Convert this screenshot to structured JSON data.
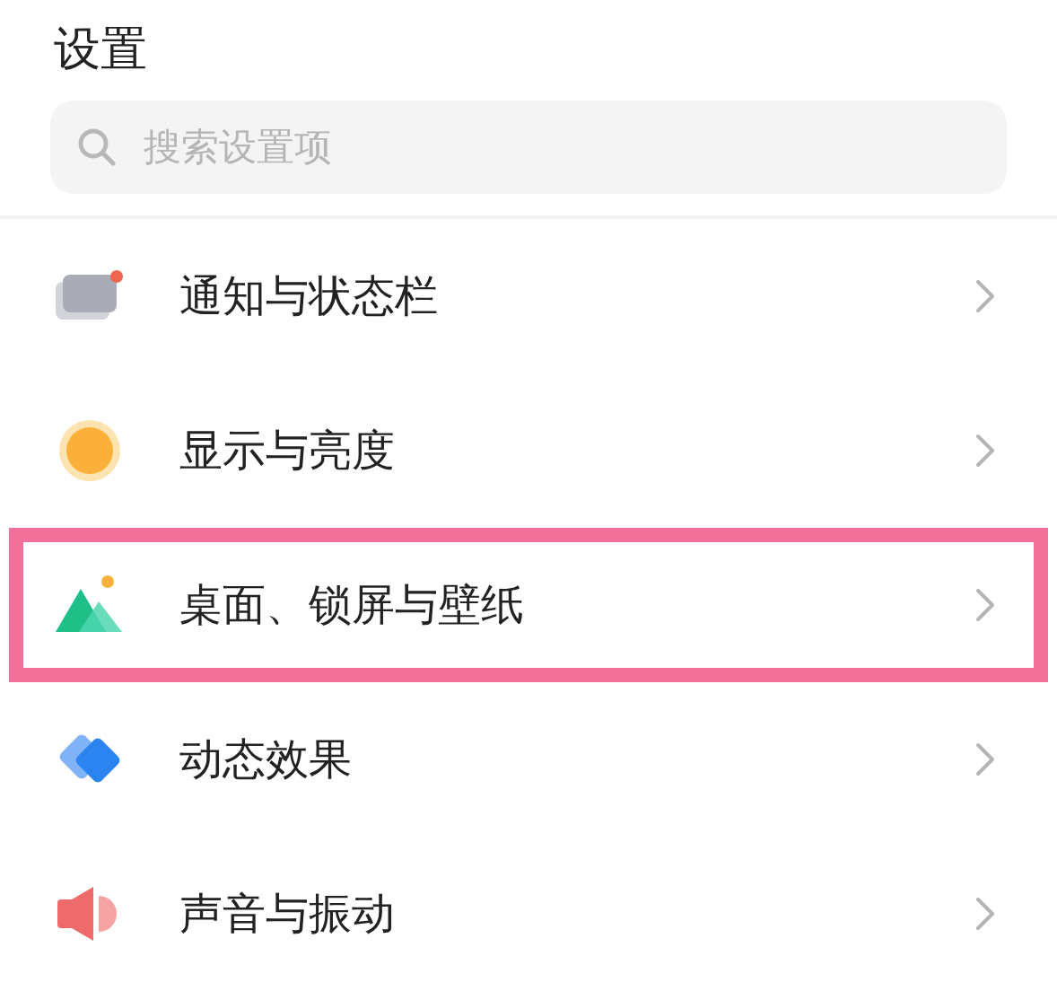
{
  "title": "设置",
  "search": {
    "placeholder": "搜索设置项"
  },
  "items": [
    {
      "label": "通知与状态栏",
      "highlighted": false
    },
    {
      "label": "显示与亮度",
      "highlighted": false
    },
    {
      "label": "桌面、锁屏与壁纸",
      "highlighted": true
    },
    {
      "label": "动态效果",
      "highlighted": false
    },
    {
      "label": "声音与振动",
      "highlighted": false
    }
  ]
}
